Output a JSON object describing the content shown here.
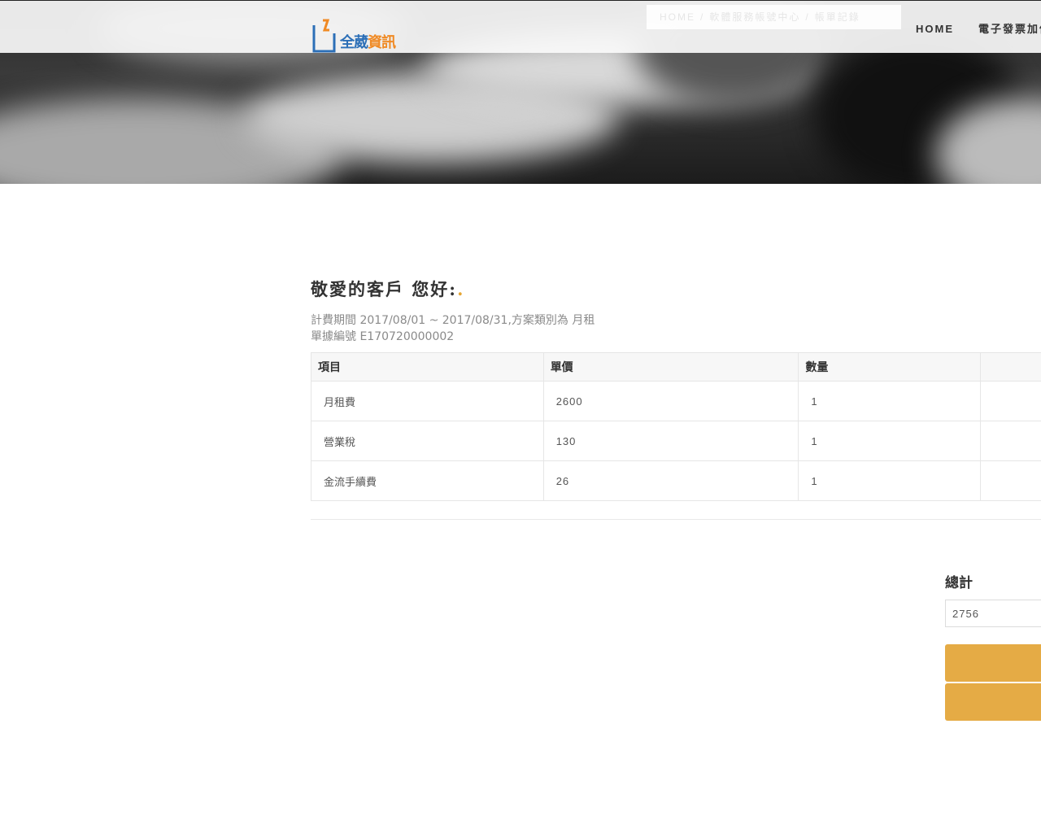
{
  "header": {
    "logo": {
      "text_blue": "全葳",
      "text_orange": "資訊"
    },
    "breadcrumb": [
      "HOME",
      "軟體服務帳號中心",
      "帳單記錄"
    ],
    "nav": [
      "HOME",
      "電子發票加值"
    ]
  },
  "main": {
    "greeting": "敬愛的客戶 您好:",
    "greeting_dot": ".",
    "billing_period": "計費期間 2017/08/01 ~ 2017/08/31,方案類別為 月租",
    "bill_number": "單據編號  E170720000002",
    "table": {
      "headers": [
        "項目",
        "單價",
        "數量"
      ],
      "rows": [
        [
          "月租費",
          "2600",
          "1"
        ],
        [
          "營業稅",
          "130",
          "1"
        ],
        [
          "金流手續費",
          "26",
          "1"
        ]
      ]
    },
    "total_label": "總計",
    "total_value": "2756"
  },
  "colors": {
    "accent": "#e5ab45",
    "logo_blue": "#2c6fb7",
    "logo_orange": "#f08a24"
  }
}
